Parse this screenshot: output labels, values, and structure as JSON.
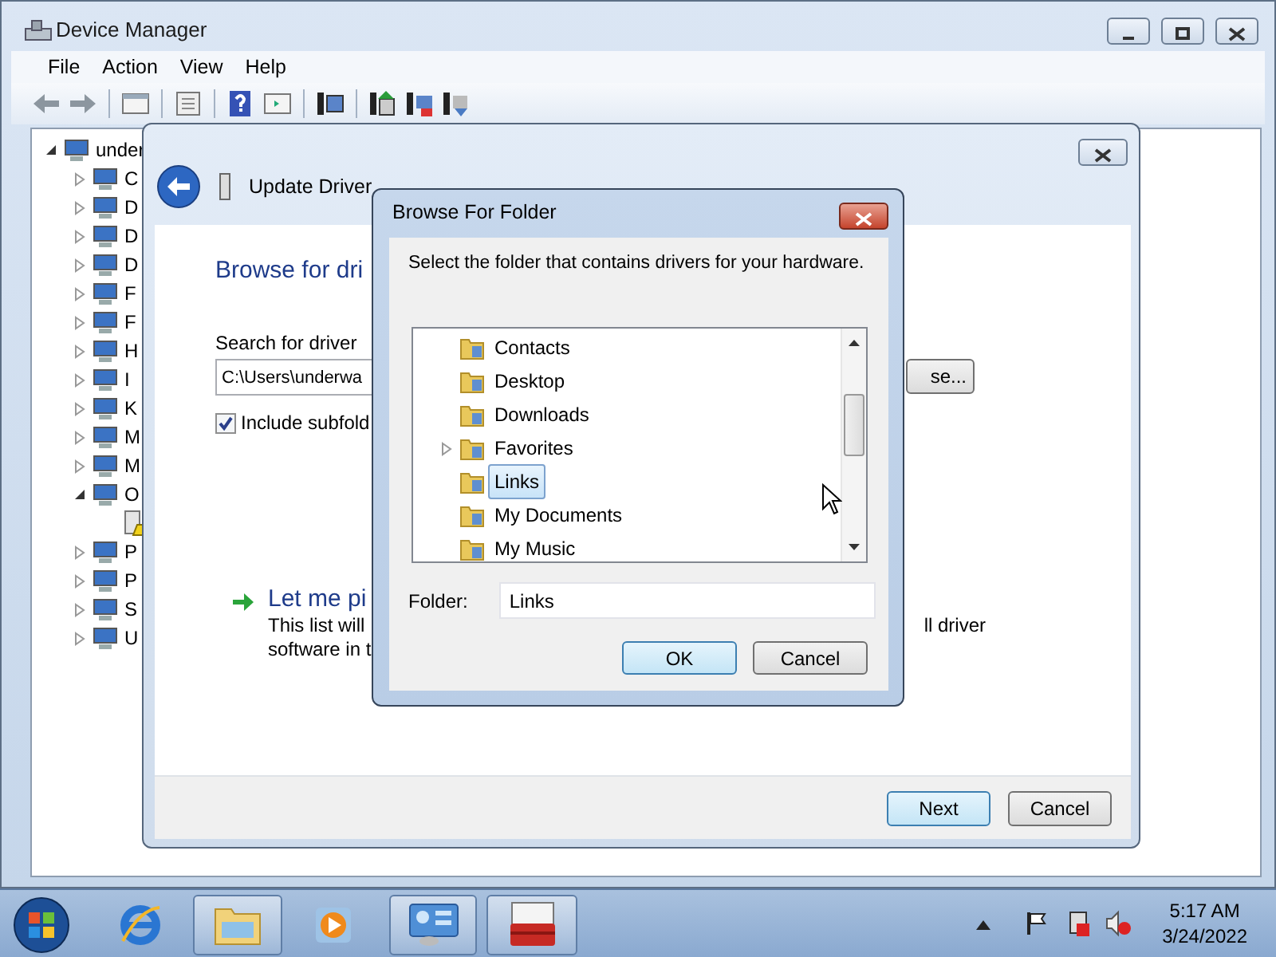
{
  "device_manager": {
    "title": "Device Manager",
    "menu": [
      "File",
      "Action",
      "View",
      "Help"
    ],
    "tree": {
      "text": "under",
      "expanded": true,
      "children": [
        {
          "text": "C",
          "expanded": false
        },
        {
          "text": "D",
          "expanded": false
        },
        {
          "text": "D",
          "expanded": false
        },
        {
          "text": "D",
          "expanded": false
        },
        {
          "text": "F",
          "expanded": false
        },
        {
          "text": "F",
          "expanded": false
        },
        {
          "text": "H",
          "expanded": false
        },
        {
          "text": "I",
          "expanded": false
        },
        {
          "text": "K",
          "expanded": false
        },
        {
          "text": "M",
          "expanded": false
        },
        {
          "text": "M",
          "expanded": false
        },
        {
          "text": "O",
          "expanded": true,
          "children": [
            {
              "kind": "device"
            }
          ]
        },
        {
          "text": "P",
          "expanded": false
        },
        {
          "text": "P",
          "expanded": false
        },
        {
          "text": "S",
          "expanded": false
        },
        {
          "text": "U",
          "expanded": false
        }
      ]
    }
  },
  "wizard": {
    "title": "Update Driver",
    "heading": "Browse for dri",
    "search_label": "Search for driver",
    "path": "C:\\Users\\underwa",
    "browse_button": "se...",
    "include_subfolders": {
      "label": "Include subfold",
      "checked": true
    },
    "option": {
      "title": "Let me pi",
      "lines": [
        "This list will",
        "software in t"
      ],
      "line_right": "ll driver"
    },
    "buttons": [
      {
        "label": "Next",
        "default": true
      },
      {
        "label": "Cancel",
        "default": false
      }
    ]
  },
  "browse_dialog": {
    "title": "Browse For Folder",
    "instruction": "Select the folder that contains drivers for your hardware.",
    "folders": [
      {
        "label": "Contacts",
        "expandable": false,
        "selected": false
      },
      {
        "label": "Desktop",
        "expandable": false,
        "selected": false
      },
      {
        "label": "Downloads",
        "expandable": false,
        "selected": false
      },
      {
        "label": "Favorites",
        "expandable": true,
        "selected": false
      },
      {
        "label": "Links",
        "expandable": false,
        "selected": true
      },
      {
        "label": "My Documents",
        "expandable": false,
        "selected": false
      },
      {
        "label": "My Music",
        "expandable": false,
        "selected": false
      }
    ],
    "folder_label": "Folder:",
    "folder_value": "Links",
    "buttons": [
      {
        "label": "OK",
        "default": true
      },
      {
        "label": "Cancel",
        "default": false
      }
    ]
  },
  "taskbar": {
    "items": [
      {
        "kind": "start",
        "running": false
      },
      {
        "kind": "browser",
        "running": false
      },
      {
        "kind": "explorer",
        "running": true
      },
      {
        "kind": "media",
        "running": false
      },
      {
        "kind": "panel",
        "running": true
      },
      {
        "kind": "toolbox",
        "running": true
      }
    ],
    "time": "5:17 AM",
    "date": "3/24/2022"
  }
}
